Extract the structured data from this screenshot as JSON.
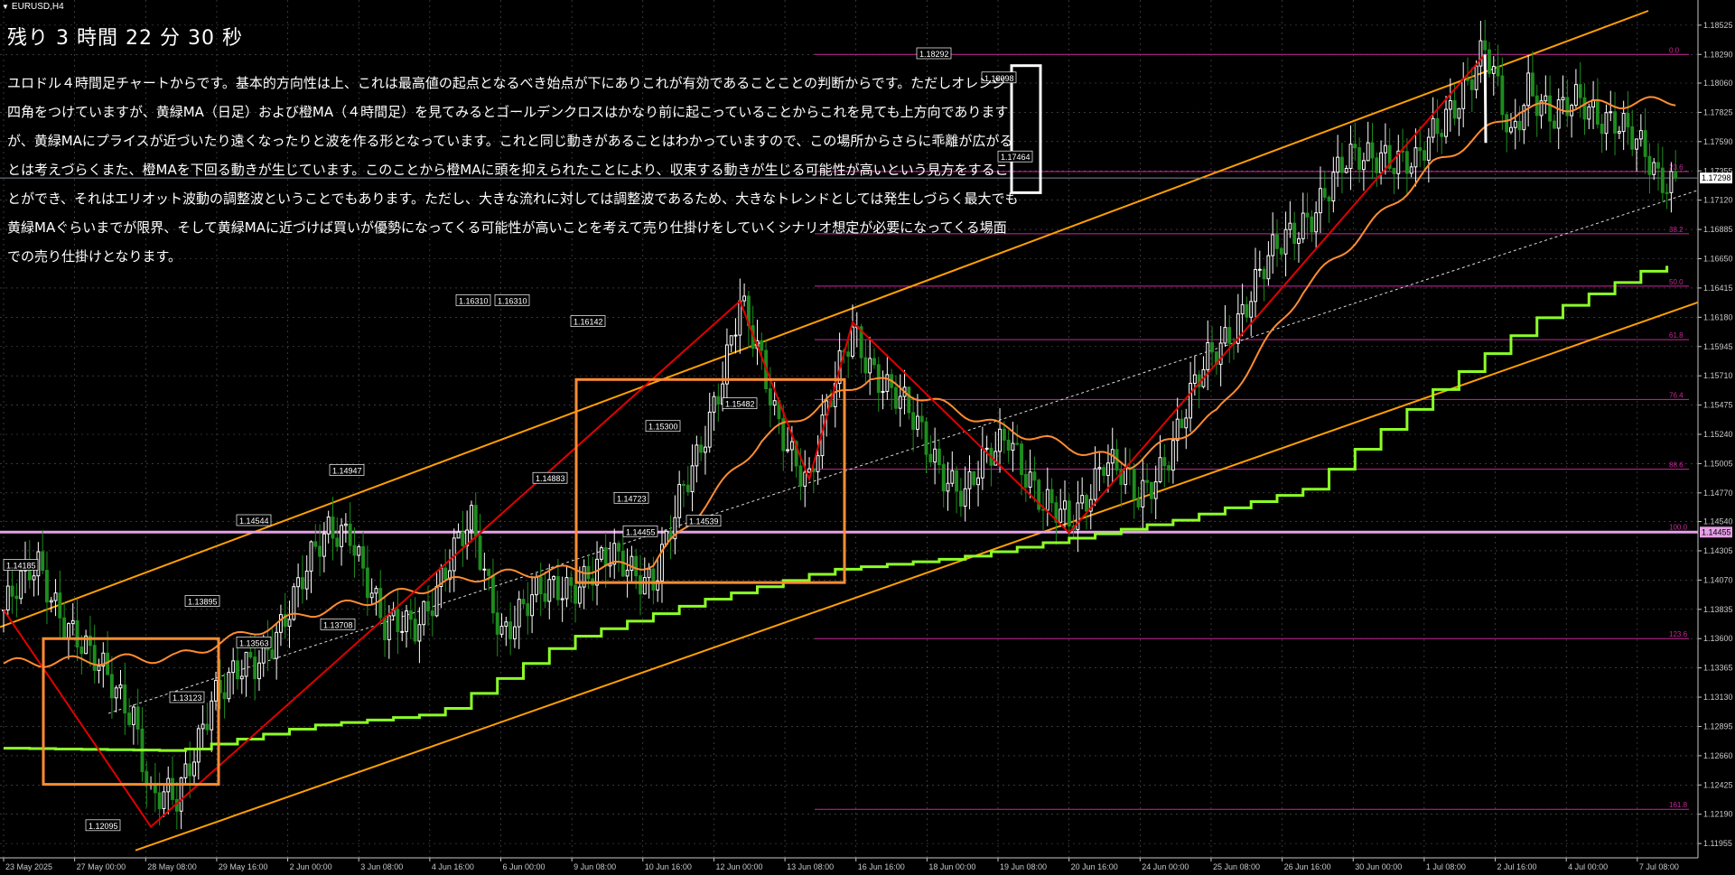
{
  "window": {
    "symbol_timeframe": "EURUSD,H4"
  },
  "overlay": {
    "countdown": "残り 3 時間 22 分 30 秒",
    "commentary": "ユロドル４時間足チャートからです。基本的方向性は上、これは最高値の起点となるべき始点が下にありこれが有効であることことの判断からです。ただしオレンジ四角をつけていますが、黄緑MA（日足）および橙MA（４時間足）を見てみるとゴールデンクロスはかなり前に起こっていることからこれを見ても上方向でありますが、黄緑MAにプライスが近づいたり遠くなったりと波を作る形となっています。これと同じ動きがあることはわかっていますので、この場所からさらに乖離が広がるとは考えづらくまた、橙MAを下回る動きが生じています。このことから橙MAに頭を抑えられたことにより、収束する動きが生じる可能性が高いという見方をすることができ、それはエリオット波動の調整波ということでもあります。ただし、大きな流れに対しては調整波であるため、大きなトレンドとしては発生しづらく最大でも黄緑MAぐらいまでが限界、そして黄緑MAに近づけば買いが優勢になってくる可能性が高いことを考えて売り仕掛けをしていくシナリオ想定が必要になってくる場面での売り仕掛けとなります。"
  },
  "colors": {
    "background": "#000000",
    "grid": "#5a5a5a",
    "axis": "#c8c8c8",
    "bull": "#ffffff",
    "bear": "#1e8c1e",
    "orange_ma": "#ff8c32",
    "daily_ma": "#8cff28",
    "channel": "#ffa000",
    "zigzag": "#e00000",
    "fib": "#c8289a",
    "box": "#ff8c32",
    "trend_white": "#ffffff",
    "support_pink": "#e6a0e6",
    "current_price_line": "#7a8a9a"
  },
  "chart_data": {
    "type": "candlestick",
    "symbol": "EURUSD",
    "timeframe": "H4",
    "ylim": [
      1.1184,
      1.1864
    ],
    "y_ticks": [
      "1.18525",
      "1.18290",
      "1.18060",
      "1.17825",
      "1.17590",
      "1.17355",
      "1.17120",
      "1.16885",
      "1.16650",
      "1.16415",
      "1.16180",
      "1.15945",
      "1.15710",
      "1.15475",
      "1.15240",
      "1.15005",
      "1.14770",
      "1.14540",
      "1.14305",
      "1.14070",
      "1.13835",
      "1.13600",
      "1.13365",
      "1.13130",
      "1.12895",
      "1.12660",
      "1.12425",
      "1.12190",
      "1.11955"
    ],
    "x_labels": [
      "23 May 2025",
      "27 May 00:00",
      "28 May 08:00",
      "29 May 16:00",
      "2 Jun 00:00",
      "3 Jun 08:00",
      "4 Jun 16:00",
      "6 Jun 00:00",
      "9 Jun 08:00",
      "10 Jun 16:00",
      "12 Jun 00:00",
      "13 Jun 08:00",
      "16 Jun 16:00",
      "18 Jun 00:00",
      "19 Jun 08:00",
      "20 Jun 16:00",
      "24 Jun 00:00",
      "25 Jun 08:00",
      "26 Jun 16:00",
      "30 Jun 00:00",
      "1 Jul 08:00",
      "2 Jul 16:00",
      "4 Jul 00:00",
      "7 Jul 08:00"
    ],
    "price_keypoints": [
      [
        0,
        1.1383
      ],
      [
        8,
        1.1418
      ],
      [
        20,
        1.1341
      ],
      [
        30,
        1.1305
      ],
      [
        34,
        1.1232
      ],
      [
        40,
        1.1226
      ],
      [
        48,
        1.1318
      ],
      [
        58,
        1.1335
      ],
      [
        66,
        1.139
      ],
      [
        75,
        1.1442
      ],
      [
        80,
        1.1452
      ],
      [
        88,
        1.1363
      ],
      [
        95,
        1.1374
      ],
      [
        108,
        1.1449
      ],
      [
        115,
        1.137
      ],
      [
        128,
        1.1402
      ],
      [
        140,
        1.142
      ],
      [
        150,
        1.1412
      ],
      [
        160,
        1.15
      ],
      [
        170,
        1.1631
      ],
      [
        178,
        1.154
      ],
      [
        186,
        1.1488
      ],
      [
        196,
        1.161
      ],
      [
        204,
        1.156
      ],
      [
        212,
        1.1524
      ],
      [
        222,
        1.1472
      ],
      [
        232,
        1.153
      ],
      [
        240,
        1.1462
      ],
      [
        246,
        1.1454
      ],
      [
        254,
        1.1505
      ],
      [
        262,
        1.147
      ],
      [
        270,
        1.152
      ],
      [
        278,
        1.158
      ],
      [
        290,
        1.165
      ],
      [
        300,
        1.1698
      ],
      [
        310,
        1.1738
      ],
      [
        318,
        1.1755
      ],
      [
        326,
        1.1735
      ],
      [
        334,
        1.179
      ],
      [
        342,
        1.1829
      ],
      [
        348,
        1.176
      ],
      [
        352,
        1.181
      ],
      [
        358,
        1.1775
      ],
      [
        364,
        1.179
      ],
      [
        372,
        1.178
      ],
      [
        378,
        1.1748
      ],
      [
        382,
        1.1728
      ],
      [
        386,
        1.1733
      ]
    ],
    "series": [
      {
        "name": "orange_ma_h4",
        "keypoints": [
          [
            0,
            1.134
          ],
          [
            40,
            1.1345
          ],
          [
            70,
            1.138
          ],
          [
            110,
            1.141
          ],
          [
            150,
            1.142
          ],
          [
            175,
            1.152
          ],
          [
            200,
            1.157
          ],
          [
            230,
            1.153
          ],
          [
            260,
            1.15
          ],
          [
            280,
            1.154
          ],
          [
            300,
            1.164
          ],
          [
            330,
            1.174
          ],
          [
            350,
            1.1785
          ],
          [
            386,
            1.1792
          ]
        ]
      },
      {
        "name": "daily_ma_green",
        "keypoints": [
          [
            0,
            1.1272
          ],
          [
            40,
            1.127
          ],
          [
            70,
            1.129
          ],
          [
            100,
            1.13
          ],
          [
            130,
            1.136
          ],
          [
            160,
            1.139
          ],
          [
            190,
            1.1415
          ],
          [
            220,
            1.1425
          ],
          [
            245,
            1.144
          ],
          [
            270,
            1.1455
          ],
          [
            300,
            1.148
          ],
          [
            330,
            1.156
          ],
          [
            355,
            1.162
          ],
          [
            380,
            1.1658
          ],
          [
            386,
            1.166
          ]
        ]
      }
    ],
    "price_labels": [
      "1.14185",
      "1.13895",
      "1.13123",
      "1.12095",
      "1.14544",
      "1.13563",
      "1.13708",
      "1.14947",
      "1.16310",
      "1.16310",
      "1.14883",
      "1.16142",
      "1.15300",
      "1.14723",
      "1.14539",
      "1.15482",
      "1.14455",
      "1.18292",
      "1.18098",
      "1.17464"
    ],
    "fibonacci": [
      {
        "label": "0.0",
        "price": 1.1829
      },
      {
        "label": "23.6",
        "price": 1.1735
      },
      {
        "label": "38.2",
        "price": 1.1685
      },
      {
        "label": "50.0",
        "price": 1.1643
      },
      {
        "label": "61.8",
        "price": 1.16
      },
      {
        "label": "76.4",
        "price": 1.1552
      },
      {
        "label": "88.6",
        "price": 1.1496
      },
      {
        "label": "100.0",
        "price": 1.1446
      },
      {
        "label": "123.6",
        "price": 1.136
      },
      {
        "label": "161.8",
        "price": 1.1223
      }
    ],
    "current_price": "1.17298",
    "support_price": "1.14455"
  }
}
